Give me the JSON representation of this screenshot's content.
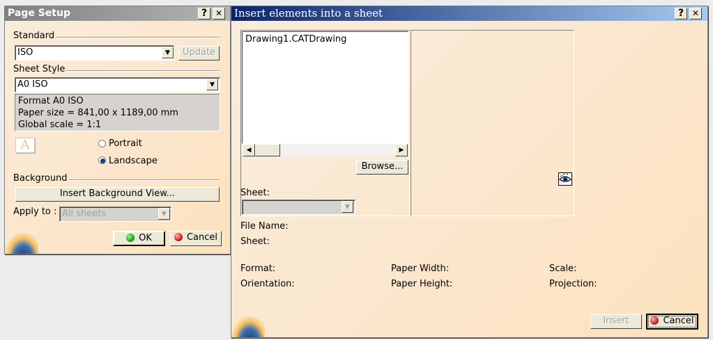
{
  "page_setup": {
    "title": "Page Setup",
    "help_btn": "?",
    "close_btn": "✕",
    "standard_label": "Standard",
    "standard_value": "ISO",
    "update_btn": "Update",
    "sheet_style_label": "Sheet Style",
    "sheet_style_value": "A0 ISO",
    "info_format": "Format A0 ISO",
    "info_paper": "Paper size = 841,00 x 1189,00 mm",
    "info_scale": "Global scale = 1:1",
    "portrait_label": "Portrait",
    "landscape_label": "Landscape",
    "orientation_selected": "Landscape",
    "background_label": "Background",
    "insert_bg_btn": "Insert Background View...",
    "apply_to_label": "Apply to :",
    "apply_to_value": "All sheets",
    "ok_btn": "OK",
    "cancel_btn": "Cancel"
  },
  "insert_dialog": {
    "title": "Insert elements into a sheet",
    "help_btn": "?",
    "close_btn": "✕",
    "files": [
      "Drawing1.CATDrawing"
    ],
    "browse_btn": "Browse...",
    "sheet_label": "Sheet:",
    "sheet_value": "",
    "file_name_label": "File Name:",
    "sheet_info_label": "Sheet:",
    "format_label": "Format:",
    "orientation_label": "Orientation:",
    "paper_width_label": "Paper Width:",
    "paper_height_label": "Paper Height:",
    "scale_label": "Scale:",
    "projection_label": "Projection:",
    "insert_btn": "Insert",
    "cancel_btn": "Cancel"
  },
  "colors": {
    "active_title": "#0a246a",
    "inactive_title": "#808080",
    "dialog_bg": "#fbe6cc",
    "ok_led": "#1fa12b",
    "cancel_led": "#d42020"
  },
  "icons": [
    "help-icon",
    "close-icon",
    "dropdown-arrow-icon",
    "paper-icon",
    "scroll-left-icon",
    "scroll-right-icon",
    "eye-preview-icon",
    "ok-led-icon",
    "cancel-led-icon",
    "globe-logo-icon"
  ]
}
